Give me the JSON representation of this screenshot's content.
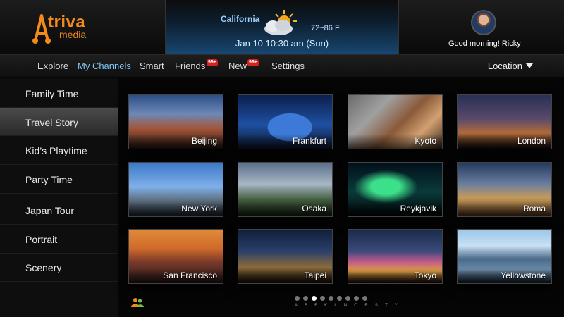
{
  "logo": {
    "text": "triva",
    "sub": "media"
  },
  "weather": {
    "location": "California",
    "temperature": "72~86 F",
    "datetime": "Jan 10 10:30 am (Sun)",
    "icon": "sun-cloud-icon"
  },
  "user": {
    "greeting": "Good morning!  Ricky"
  },
  "nav": {
    "items": [
      {
        "label": "Explore"
      },
      {
        "label": "My Channels"
      },
      {
        "label": "Smart"
      },
      {
        "label": "Friends",
        "badge": "99+"
      },
      {
        "label": "New",
        "badge": "99+"
      },
      {
        "label": "Settings"
      }
    ],
    "location": "Location"
  },
  "sidebar": {
    "items": [
      {
        "label": "Family Time"
      },
      {
        "label": "Travel Story"
      },
      {
        "label": "Kid’s Playtime"
      },
      {
        "label": "Party Time"
      },
      {
        "label": "Japan Tour"
      },
      {
        "label": "Portrait"
      },
      {
        "label": "Scenery"
      }
    ],
    "active": "Travel Story"
  },
  "tiles": [
    {
      "label": "Beijing"
    },
    {
      "label": "Frankfurt"
    },
    {
      "label": "Kyoto"
    },
    {
      "label": "London"
    },
    {
      "label": "New York"
    },
    {
      "label": "Osaka"
    },
    {
      "label": "Reykjavik"
    },
    {
      "label": "Roma"
    },
    {
      "label": "San Francisco"
    },
    {
      "label": "Taipei"
    },
    {
      "label": "Tokyo"
    },
    {
      "label": "Yellowstone"
    }
  ],
  "pager": {
    "letters": "A B F K L N O R S T Y",
    "current_page": 3,
    "total_pages": 9
  },
  "colors": {
    "accent": "#7fc6f0",
    "logo": "#f28a1c",
    "badge": "#d82121"
  }
}
